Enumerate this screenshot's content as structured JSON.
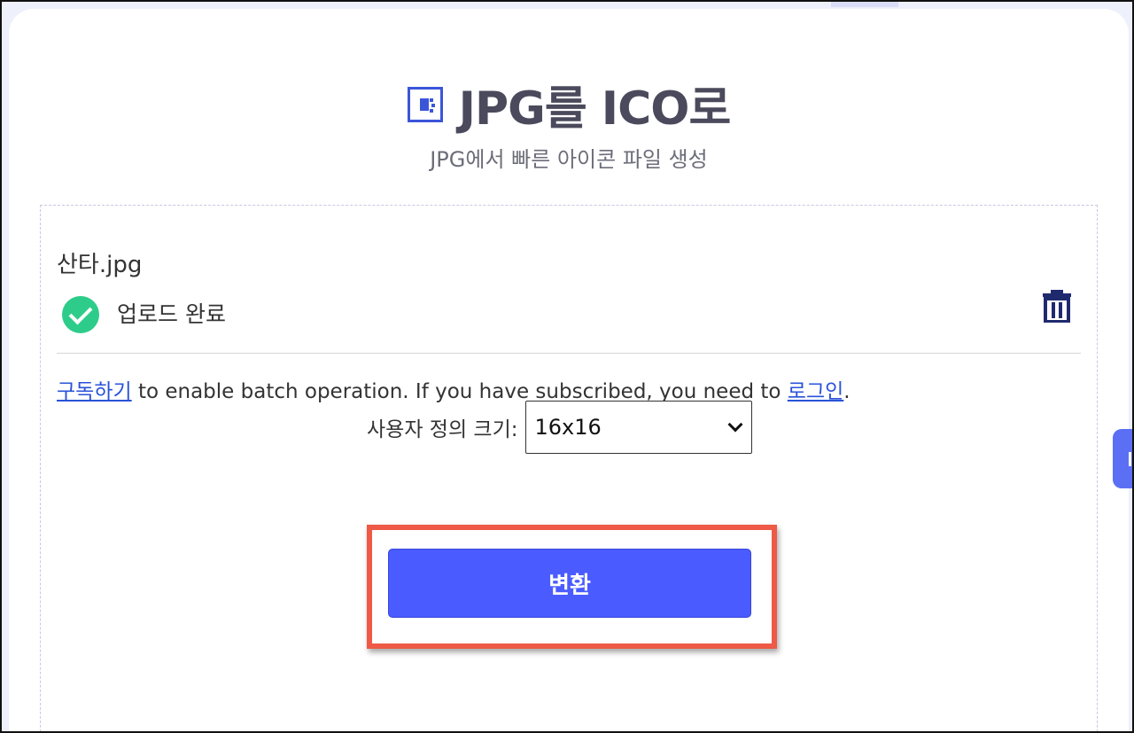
{
  "header": {
    "title": "JPG를 ICO로",
    "subtitle": "JPG에서 빠른 아이콘 파일 생성",
    "logo_icon": "ico-file-icon"
  },
  "file": {
    "name": "산타.jpg",
    "status": "업로드 완료",
    "status_icon": "check-circle-icon",
    "delete_icon": "trash-icon"
  },
  "batch_notice": {
    "subscribe_link": "구독하기",
    "middle_text": " to enable batch operation. If you have subscribed, you need to ",
    "login_link": "로그인",
    "end_text": "."
  },
  "size": {
    "label": "사용자 정의 크기:",
    "selected": "16x16"
  },
  "actions": {
    "convert_label": "변환"
  },
  "colors": {
    "accent": "#4a5cff",
    "success": "#2ecc8a",
    "highlight": "#ee5a45",
    "link": "#2a52d8"
  }
}
